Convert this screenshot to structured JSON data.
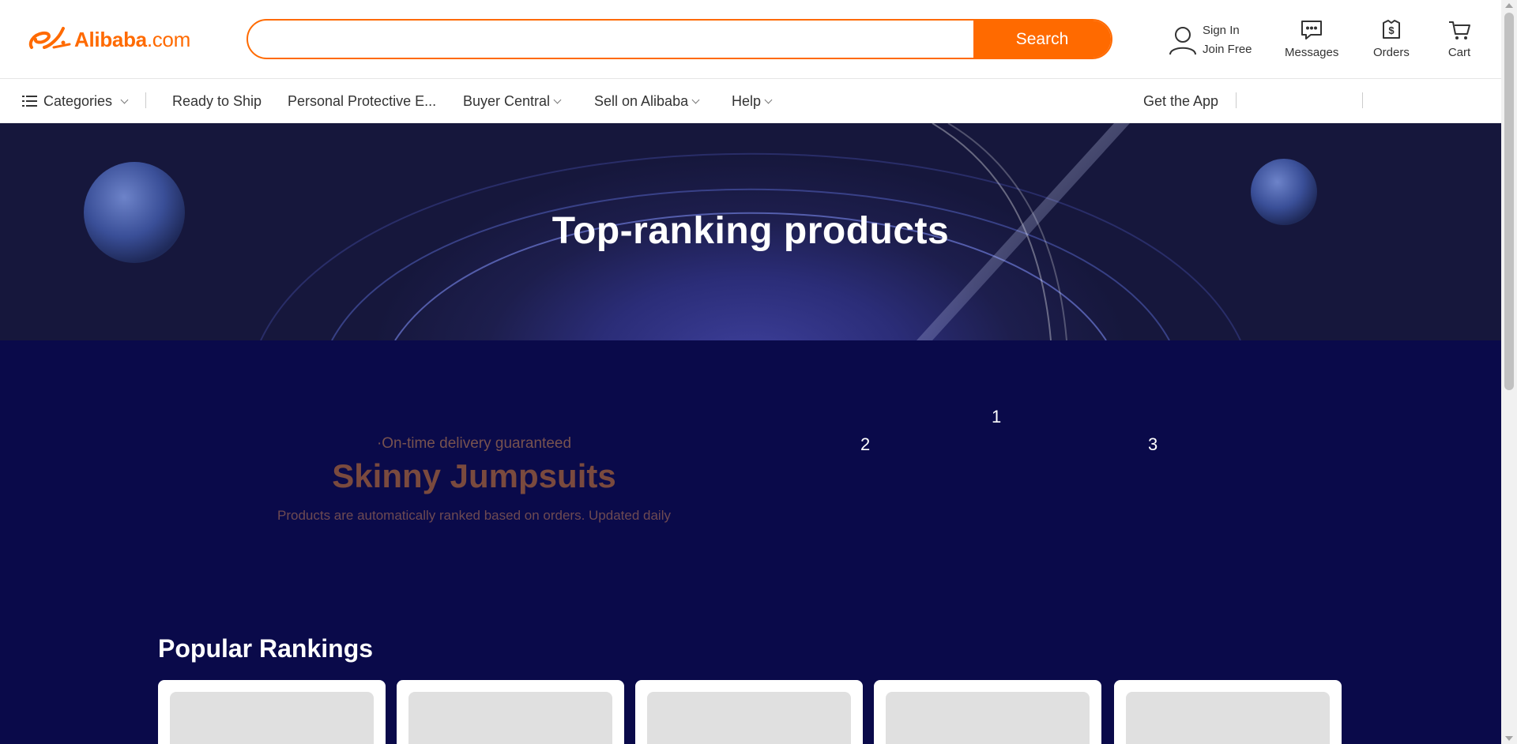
{
  "header": {
    "logo_brand": "Alibaba",
    "logo_suffix": ".com",
    "search": {
      "placeholder": "",
      "button_label": "Search"
    },
    "account": {
      "sign_in": "Sign In",
      "join_free": "Join Free"
    },
    "actions": [
      {
        "label": "Messages",
        "icon": "message-icon"
      },
      {
        "label": "Orders",
        "icon": "orders-icon"
      },
      {
        "label": "Cart",
        "icon": "cart-icon"
      }
    ]
  },
  "subnav": {
    "categories": "Categories",
    "items": [
      "Ready to Ship",
      "Personal Protective E...",
      "Buyer Central",
      "Sell on Alibaba",
      "Help"
    ],
    "get_app": "Get the App"
  },
  "banner": {
    "title": "Top-ranking products"
  },
  "ranking": {
    "badge": "·On-time delivery guaranteed",
    "title": "Skinny Jumpsuits",
    "description": "Products are automatically ranked based on orders. Updated daily",
    "podium": [
      "1",
      "2",
      "3"
    ]
  },
  "popular": {
    "title": "Popular Rankings",
    "card_count": 5
  },
  "colors": {
    "brand": "#ff6a00",
    "dark_bg": "#0a0a4a",
    "title_brown": "#7a4a3e"
  }
}
